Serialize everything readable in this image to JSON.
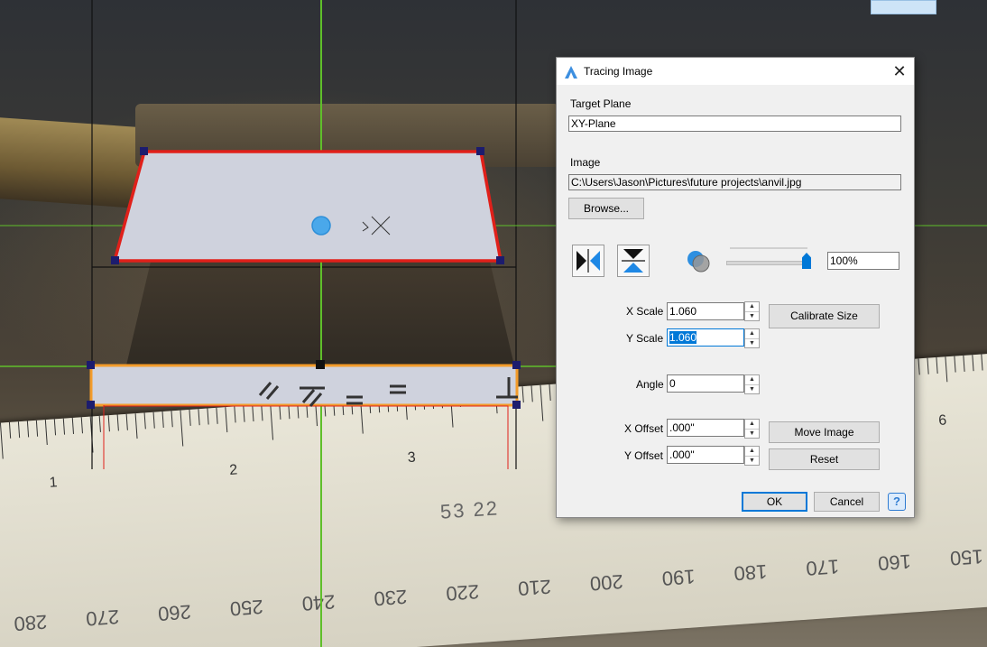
{
  "dialog": {
    "title": "Tracing Image",
    "close_icon": "close-icon",
    "target_plane": {
      "label": "Target Plane",
      "value": "XY-Plane"
    },
    "image": {
      "label": "Image",
      "path": "C:\\Users\\Jason\\Pictures\\future projects\\anvil.jpg",
      "browse_label": "Browse..."
    },
    "tools": {
      "flip_horizontal_icon": "flip-horizontal-icon",
      "flip_vertical_icon": "flip-vertical-icon",
      "transparency_icon": "transparency-icon"
    },
    "opacity": {
      "value": "100%",
      "level": 1.0
    },
    "x_scale": {
      "label": "X Scale",
      "value": "1.060"
    },
    "y_scale": {
      "label": "Y Scale",
      "value": "1.060"
    },
    "calibrate_label": "Calibrate Size",
    "angle": {
      "label": "Angle",
      "value": "0"
    },
    "x_offset": {
      "label": "X Offset",
      "value": ".000\""
    },
    "y_offset": {
      "label": "Y Offset",
      "value": ".000\""
    },
    "move_image_label": "Move Image",
    "reset_label": "Reset",
    "ok_label": "OK",
    "cancel_label": "Cancel",
    "help_label": "?"
  },
  "background": {
    "ruler_top_numbers": [
      "1",
      "2",
      "3",
      "6"
    ],
    "ruler_bottom_numbers": [
      "280",
      "270",
      "260",
      "250",
      "240",
      "230",
      "220",
      "210",
      "200",
      "190",
      "180",
      "170",
      "160",
      "150"
    ],
    "stamp": "53 22",
    "constraint_symbols": [
      "//",
      "//",
      "=",
      "=",
      "⊥"
    ]
  },
  "colors": {
    "guide_green": "#5fbf2a",
    "sketch_red": "#e0201a",
    "sketch_orange": "#f39c2b",
    "vertex_navy": "#1c1c6e",
    "fill": "#cfd2dd",
    "accent": "#0078d7"
  }
}
